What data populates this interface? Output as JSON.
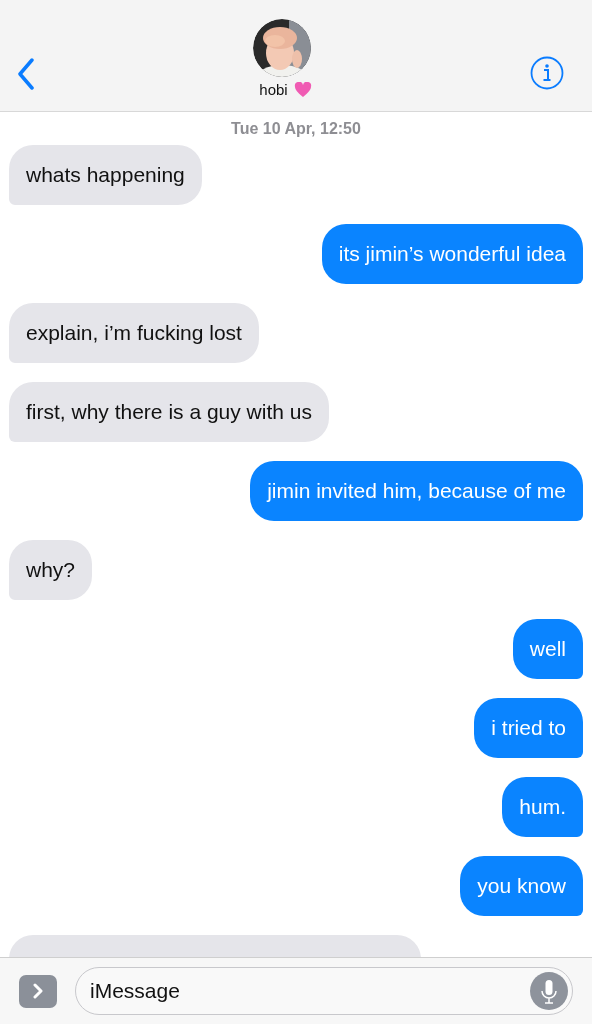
{
  "header": {
    "name": "hobi"
  },
  "timestamp": "Tue 10 Apr, 12:50",
  "messages": [
    {
      "outgoing": false,
      "text": "whats happening"
    },
    {
      "outgoing": true,
      "text": "its jimin’s wonderful idea"
    },
    {
      "outgoing": false,
      "text": "explain, i’m fucking lost"
    },
    {
      "outgoing": false,
      "text": "first, why there is a guy with us"
    },
    {
      "outgoing": true,
      "text": "jimin invited him, because of me"
    },
    {
      "outgoing": false,
      "text": "why?"
    },
    {
      "outgoing": true,
      "text": "well"
    },
    {
      "outgoing": true,
      "text": "i tried to"
    },
    {
      "outgoing": true,
      "text": "hum."
    },
    {
      "outgoing": true,
      "text": "you know"
    },
    {
      "outgoing": false,
      "partial": true
    }
  ],
  "composer": {
    "placeholder": "iMessage"
  }
}
